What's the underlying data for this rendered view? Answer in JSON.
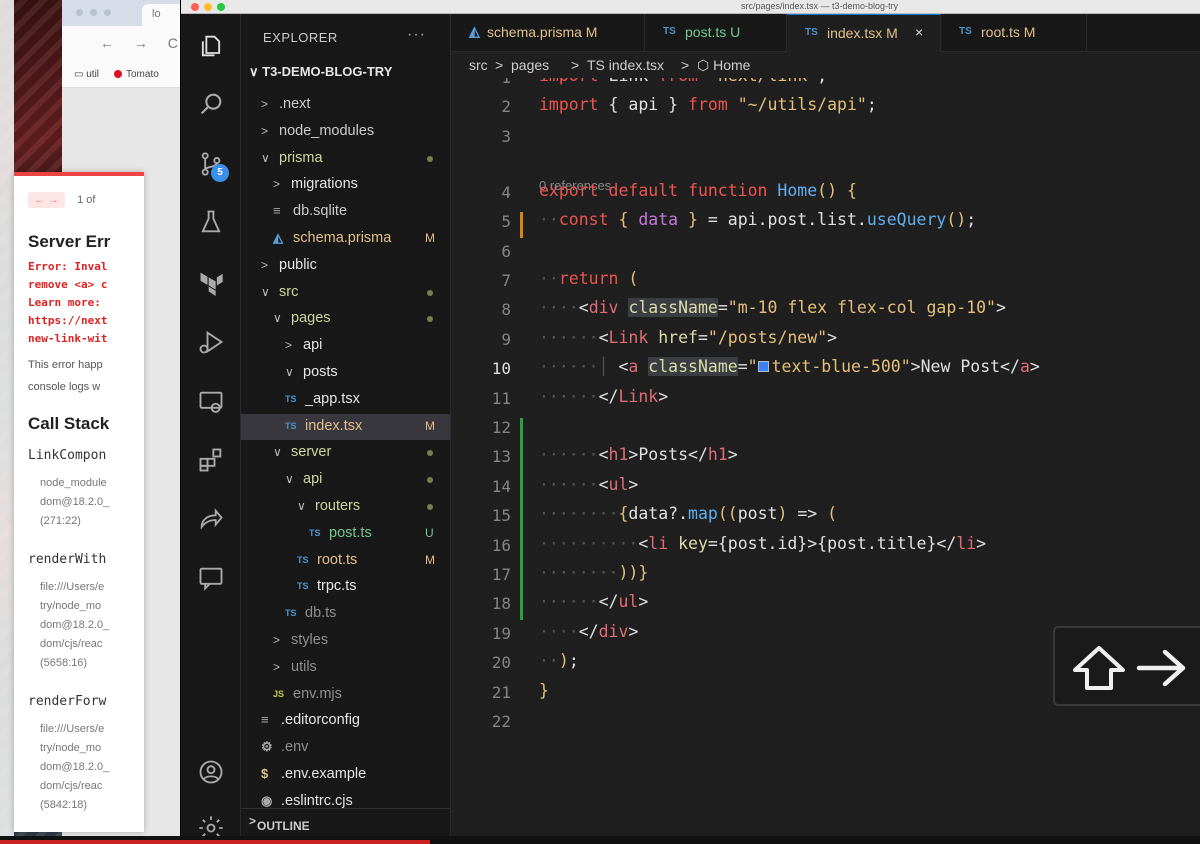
{
  "window_title": "src/pages/index.tsx — t3-demo-blog-try",
  "browser": {
    "tab_title": "lo",
    "nav_buttons": "← → C",
    "url_pill": "ⓘ",
    "bookmarks": [
      "util",
      "Tomato"
    ],
    "error_overlay": {
      "pager_arrows": "← →",
      "pager_text": "1 of",
      "title": "Server Err",
      "error_text": "Error: Inval\nremove <a> c\nLearn more:\nhttps://next\nnew-link-wit",
      "note": "This error happ\nconsole logs w",
      "callstack_title": "Call Stack",
      "frames": [
        {
          "name": "LinkCompon",
          "loc": "node_module\ndom@18.2.0_\n(271:22)"
        },
        {
          "name": "renderWith",
          "loc": "file:///Users/e\ntry/node_mo\ndom@18.2.0_\ndom/cjs/reac\n(5658:16)"
        },
        {
          "name": "renderForw",
          "loc": "file:///Users/e\ntry/node_mo\ndom@18.2.0_\ndom/cjs/reac\n(5842:18)"
        }
      ]
    }
  },
  "activity": {
    "scm_badge": "5",
    "icons": [
      "files-icon",
      "search-icon",
      "source-control-icon",
      "testing-icon",
      "terraform-icon",
      "run-debug-icon",
      "remote-explorer-icon",
      "extensions-icon",
      "live-share-icon",
      "comments-icon",
      "account-icon",
      "settings-gear-icon"
    ]
  },
  "explorer": {
    "header": "EXPLORER",
    "more": "···",
    "project": "T3-DEMO-BLOG-TRY",
    "outline": "OUTLINE",
    "tree": [
      {
        "label": ".next",
        "chev": ">",
        "icon": "",
        "indent": 0,
        "status": "",
        "dot": false,
        "color": "normal"
      },
      {
        "label": "node_modules",
        "chev": ">",
        "icon": "",
        "indent": 0,
        "status": "",
        "dot": false,
        "color": "normal"
      },
      {
        "label": "prisma",
        "chev": "∨",
        "icon": "",
        "indent": 0,
        "status": "",
        "dot": true,
        "color": "folder-green"
      },
      {
        "label": "migrations",
        "chev": ">",
        "icon": "",
        "indent": 1,
        "status": "",
        "dot": false,
        "color": "bright"
      },
      {
        "label": "db.sqlite",
        "chev": "",
        "icon": "≡",
        "indent": 1,
        "status": "",
        "dot": false,
        "color": "normal"
      },
      {
        "label": "schema.prisma",
        "chev": "",
        "icon": "◭",
        "indent": 1,
        "status": "M",
        "dot": false,
        "color": "mod"
      },
      {
        "label": "public",
        "chev": ">",
        "icon": "",
        "indent": 0,
        "status": "",
        "dot": false,
        "color": "bright"
      },
      {
        "label": "src",
        "chev": "∨",
        "icon": "",
        "indent": 0,
        "status": "",
        "dot": true,
        "color": "folder-green"
      },
      {
        "label": "pages",
        "chev": "∨",
        "icon": "",
        "indent": 1,
        "status": "",
        "dot": true,
        "color": "folder-green"
      },
      {
        "label": "api",
        "chev": ">",
        "icon": "",
        "indent": 2,
        "status": "",
        "dot": false,
        "color": "bright"
      },
      {
        "label": "posts",
        "chev": "∨",
        "icon": "",
        "indent": 2,
        "status": "",
        "dot": false,
        "color": "bright"
      },
      {
        "label": "_app.tsx",
        "chev": "",
        "icon": "TS",
        "indent": 2,
        "status": "",
        "dot": false,
        "color": "bright"
      },
      {
        "label": "index.tsx",
        "chev": "",
        "icon": "TS",
        "indent": 2,
        "status": "M",
        "dot": false,
        "color": "mod",
        "selected": true
      },
      {
        "label": "server",
        "chev": "∨",
        "icon": "",
        "indent": 1,
        "status": "",
        "dot": true,
        "color": "folder-green"
      },
      {
        "label": "api",
        "chev": "∨",
        "icon": "",
        "indent": 2,
        "status": "",
        "dot": true,
        "color": "folder-green"
      },
      {
        "label": "routers",
        "chev": "∨",
        "icon": "",
        "indent": 3,
        "status": "",
        "dot": true,
        "color": "folder-green"
      },
      {
        "label": "post.ts",
        "chev": "",
        "icon": "TS",
        "indent": 4,
        "status": "U",
        "dot": false,
        "color": "untracked"
      },
      {
        "label": "root.ts",
        "chev": "",
        "icon": "TS",
        "indent": 3,
        "status": "M",
        "dot": false,
        "color": "mod"
      },
      {
        "label": "trpc.ts",
        "chev": "",
        "icon": "TS",
        "indent": 3,
        "status": "",
        "dot": false,
        "color": "bright"
      },
      {
        "label": "db.ts",
        "chev": "",
        "icon": "TS",
        "indent": 2,
        "status": "",
        "dot": false,
        "color": "dim"
      },
      {
        "label": "styles",
        "chev": ">",
        "icon": "",
        "indent": 1,
        "status": "",
        "dot": false,
        "color": "dim"
      },
      {
        "label": "utils",
        "chev": ">",
        "icon": "",
        "indent": 1,
        "status": "",
        "dot": false,
        "color": "dim"
      },
      {
        "label": "env.mjs",
        "chev": "",
        "icon": "JS",
        "indent": 1,
        "status": "",
        "dot": false,
        "color": "dim"
      },
      {
        "label": ".editorconfig",
        "chev": "",
        "icon": "≡",
        "indent": 0,
        "status": "",
        "dot": false,
        "color": "bright"
      },
      {
        "label": ".env",
        "chev": "",
        "icon": "⚙",
        "indent": 0,
        "status": "",
        "dot": false,
        "color": "dim"
      },
      {
        "label": ".env.example",
        "chev": "",
        "icon": "$",
        "indent": 0,
        "status": "",
        "dot": false,
        "color": "bright"
      },
      {
        "label": ".eslintrc.cjs",
        "chev": "",
        "icon": "◉",
        "indent": 0,
        "status": "",
        "dot": false,
        "color": "bright"
      }
    ]
  },
  "tabs": [
    {
      "icon": "◭",
      "label": "schema.prisma",
      "status": "M",
      "active": false
    },
    {
      "icon": "TS",
      "label": "post.ts",
      "status": "U",
      "active": false
    },
    {
      "icon": "TS",
      "label": "index.tsx",
      "status": "M",
      "active": true,
      "close": "×"
    },
    {
      "icon": "TS",
      "label": "root.ts",
      "status": "M",
      "active": false
    }
  ],
  "breadcrumb": [
    "src",
    ">",
    "pages",
    ">",
    "TS index.tsx",
    ">",
    "⬡ Home"
  ],
  "codelens": "0 references",
  "current_line": 10,
  "line_numbers": [
    "1",
    "2",
    "3",
    "4",
    "5",
    "6",
    "7",
    "8",
    "9",
    "10",
    "11",
    "12",
    "13",
    "14",
    "15",
    "16",
    "17",
    "18",
    "19",
    "20",
    "21",
    "22"
  ],
  "code_lines": [
    [
      [
        "kw",
        "import "
      ],
      [
        "pl",
        "Link "
      ],
      [
        "kw",
        "from "
      ],
      [
        "str",
        "\"next/link\""
      ],
      [
        "pl",
        ";"
      ]
    ],
    [
      [
        "kw",
        "import "
      ],
      [
        "pl",
        "{ api } "
      ],
      [
        "kw",
        "from "
      ],
      [
        "str",
        "\"~/utils/api\""
      ],
      [
        "pl",
        ";"
      ]
    ],
    [],
    [
      [
        "kw",
        "export default function "
      ],
      [
        "fn",
        "Home"
      ],
      [
        "br",
        "() {"
      ]
    ],
    [
      [
        "ws",
        "··"
      ],
      [
        "kw",
        "const "
      ],
      [
        "br",
        "{ "
      ],
      [
        "prop",
        "data "
      ],
      [
        "br",
        "} "
      ],
      [
        "pl",
        "= api.post.list."
      ],
      [
        "fn",
        "useQuery"
      ],
      [
        "br",
        "()"
      ],
      [
        "pl",
        ";"
      ]
    ],
    [],
    [
      [
        "ws",
        "··"
      ],
      [
        "kw",
        "return "
      ],
      [
        "br",
        "("
      ]
    ],
    [
      [
        "ws",
        "····"
      ],
      [
        "pl",
        "<"
      ],
      [
        "tag",
        "div "
      ],
      [
        "attr",
        "className"
      ],
      [
        "pl",
        "="
      ],
      [
        "str",
        "\"m-10 flex flex-col gap-10\""
      ],
      [
        "pl",
        ">"
      ]
    ],
    [
      [
        "ws",
        "······"
      ],
      [
        "pl",
        "<"
      ],
      [
        "tag",
        "Link "
      ],
      [
        "attr",
        "href"
      ],
      [
        "pl",
        "="
      ],
      [
        "str",
        "\"/posts/new\""
      ],
      [
        "pl",
        ">"
      ]
    ],
    [
      [
        "ws",
        "······"
      ],
      [
        "ws",
        "│ "
      ],
      [
        "pl",
        "<"
      ],
      [
        "tag",
        "a "
      ],
      [
        "attr",
        "className"
      ],
      [
        "pl",
        "="
      ],
      [
        "str",
        "\""
      ],
      [
        "swatch",
        ""
      ],
      [
        "str",
        "text-blue-500\""
      ],
      [
        "pl",
        ">New Post</"
      ],
      [
        "tag",
        "a"
      ],
      [
        "pl",
        ">"
      ]
    ],
    [
      [
        "ws",
        "······"
      ],
      [
        "pl",
        "</"
      ],
      [
        "tag",
        "Link"
      ],
      [
        "pl",
        ">"
      ]
    ],
    [],
    [
      [
        "ws",
        "······"
      ],
      [
        "pl",
        "<"
      ],
      [
        "tag",
        "h1"
      ],
      [
        "pl",
        ">Posts</"
      ],
      [
        "tag",
        "h1"
      ],
      [
        "pl",
        ">"
      ]
    ],
    [
      [
        "ws",
        "······"
      ],
      [
        "pl",
        "<"
      ],
      [
        "tag",
        "ul"
      ],
      [
        "pl",
        ">"
      ]
    ],
    [
      [
        "ws",
        "········"
      ],
      [
        "br",
        "{"
      ],
      [
        "pl",
        "data?."
      ],
      [
        "fn",
        "map"
      ],
      [
        "br",
        "(("
      ],
      [
        "pl",
        "post"
      ],
      [
        "br",
        ") "
      ],
      [
        "pl",
        "=> "
      ],
      [
        "br",
        "("
      ]
    ],
    [
      [
        "ws",
        "··········"
      ],
      [
        "pl",
        "<"
      ],
      [
        "tag",
        "li "
      ],
      [
        "attr",
        "key"
      ],
      [
        "pl",
        "={post.id}>{post.title}</"
      ],
      [
        "tag",
        "li"
      ],
      [
        "pl",
        ">"
      ]
    ],
    [
      [
        "ws",
        "········"
      ],
      [
        "br",
        "))}"
      ]
    ],
    [
      [
        "ws",
        "······"
      ],
      [
        "pl",
        "</"
      ],
      [
        "tag",
        "ul"
      ],
      [
        "pl",
        ">"
      ]
    ],
    [
      [
        "ws",
        "····"
      ],
      [
        "pl",
        "</"
      ],
      [
        "tag",
        "div"
      ],
      [
        "pl",
        ">"
      ]
    ],
    [
      [
        "ws",
        "··"
      ],
      [
        "br",
        ")"
      ],
      [
        "pl",
        ";"
      ]
    ],
    [
      [
        "br",
        "}"
      ]
    ],
    []
  ],
  "colors": {
    "accent": "#0078d4",
    "modified": "#e2c08d",
    "untracked": "#73c991",
    "keyword": "#ef5350",
    "string": "#e5c07b"
  },
  "key_overlay": {
    "keys": [
      "shift-icon",
      "arrow-right-icon"
    ]
  }
}
